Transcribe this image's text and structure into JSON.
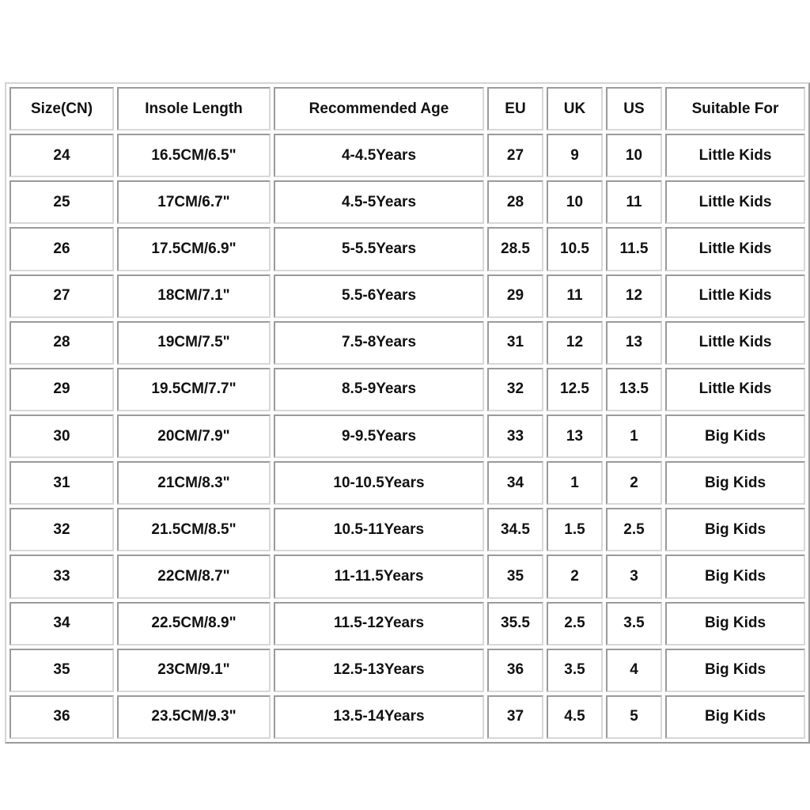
{
  "table": {
    "headers": [
      "Size(CN)",
      "Insole Length",
      "Recommended Age",
      "EU",
      "UK",
      "US",
      "Suitable For"
    ],
    "rows": [
      [
        "24",
        "16.5CM/6.5\"",
        "4-4.5Years",
        "27",
        "9",
        "10",
        "Little Kids"
      ],
      [
        "25",
        "17CM/6.7\"",
        "4.5-5Years",
        "28",
        "10",
        "11",
        "Little Kids"
      ],
      [
        "26",
        "17.5CM/6.9\"",
        "5-5.5Years",
        "28.5",
        "10.5",
        "11.5",
        "Little Kids"
      ],
      [
        "27",
        "18CM/7.1\"",
        "5.5-6Years",
        "29",
        "11",
        "12",
        "Little Kids"
      ],
      [
        "28",
        "19CM/7.5\"",
        "7.5-8Years",
        "31",
        "12",
        "13",
        "Little Kids"
      ],
      [
        "29",
        "19.5CM/7.7\"",
        "8.5-9Years",
        "32",
        "12.5",
        "13.5",
        "Little Kids"
      ],
      [
        "30",
        "20CM/7.9\"",
        "9-9.5Years",
        "33",
        "13",
        "1",
        "Big Kids"
      ],
      [
        "31",
        "21CM/8.3\"",
        "10-10.5Years",
        "34",
        "1",
        "2",
        "Big Kids"
      ],
      [
        "32",
        "21.5CM/8.5\"",
        "10.5-11Years",
        "34.5",
        "1.5",
        "2.5",
        "Big Kids"
      ],
      [
        "33",
        "22CM/8.7\"",
        "11-11.5Years",
        "35",
        "2",
        "3",
        "Big Kids"
      ],
      [
        "34",
        "22.5CM/8.9\"",
        "11.5-12Years",
        "35.5",
        "2.5",
        "3.5",
        "Big Kids"
      ],
      [
        "35",
        "23CM/9.1\"",
        "12.5-13Years",
        "36",
        "3.5",
        "4",
        "Big Kids"
      ],
      [
        "36",
        "23.5CM/9.3\"",
        "13.5-14Years",
        "37",
        "4.5",
        "5",
        "Big Kids"
      ]
    ]
  }
}
